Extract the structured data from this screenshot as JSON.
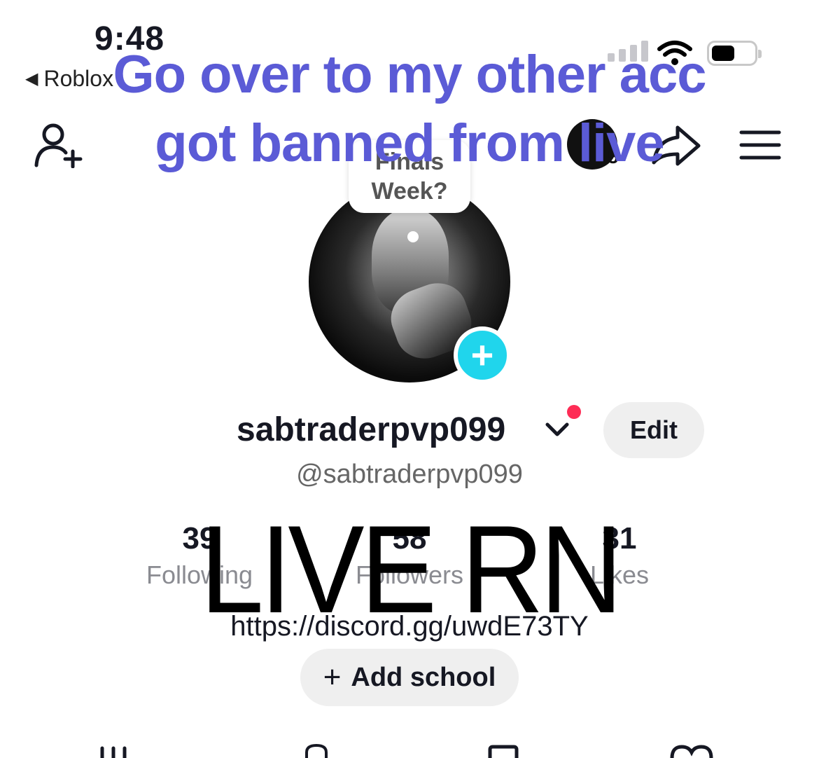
{
  "status_bar": {
    "time": "9:48",
    "back_app": "Roblox"
  },
  "header": {
    "story_count": "5"
  },
  "caption": {
    "line1": "Go over to my other acc",
    "line2": "got banned from live"
  },
  "note_bubble": {
    "line1": "Finals",
    "line2": "Week?"
  },
  "profile": {
    "username": "sabtraderpvp099",
    "handle": "@sabtraderpvp099",
    "edit_label": "Edit",
    "bio_link": "https://discord.gg/uwdE73TY",
    "add_school_label": "Add school"
  },
  "stats": [
    {
      "value": "39",
      "label": "Following"
    },
    {
      "value": "58",
      "label": "Followers"
    },
    {
      "value": "31",
      "label": "Likes"
    }
  ],
  "overlay_text": "LIVE RN",
  "colors": {
    "caption": "#5b5bd6",
    "accent_badge": "#20d5ec",
    "notification_dot": "#fe2c55"
  },
  "bottom_tabs": [
    "grid-icon",
    "lock-icon",
    "bookmark-icon",
    "heart-icon"
  ]
}
